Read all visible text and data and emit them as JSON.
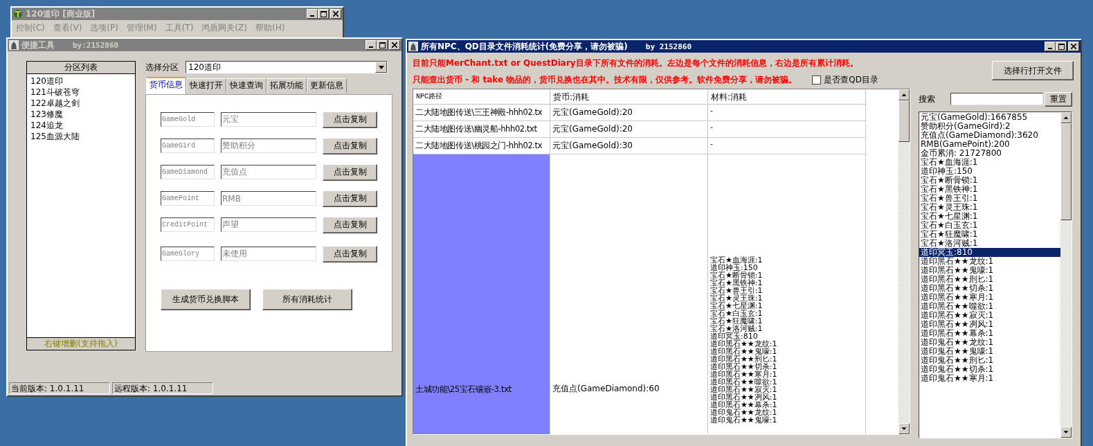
{
  "main_window": {
    "title": "120道印 [商业版]",
    "menu": [
      "控制(C)",
      "查看(V)",
      "选项(P)",
      "管理(M)",
      "工具(T)",
      "鸿盾网关(Z)",
      "帮助(H)"
    ]
  },
  "tool_window": {
    "title": "便捷工具",
    "author": "by:2152860",
    "partition_list": {
      "header": "分区列表",
      "items": [
        "120道印",
        "121斗破苍穹",
        "122卓越之剑",
        "123修魔",
        "124追龙",
        "125血源大陆"
      ],
      "footer": "右键增删(支持拖入)"
    },
    "partition_select": {
      "label": "选择分区",
      "value": "120道印"
    },
    "tabs": [
      {
        "label": "货币信息",
        "selected": true
      },
      {
        "label": "快速打开",
        "selected": false
      },
      {
        "label": "快速查询",
        "selected": false
      },
      {
        "label": "拓展功能",
        "selected": false
      },
      {
        "label": "更新信息",
        "selected": false
      }
    ],
    "currency_rows": [
      {
        "key": "GameGold",
        "name": "元宝",
        "button": "点击复制"
      },
      {
        "key": "GameGird",
        "name": "赞助积分",
        "button": "点击复制"
      },
      {
        "key": "GameDiamond",
        "name": "充值点",
        "button": "点击复制"
      },
      {
        "key": "GamePoint",
        "name": "RMB",
        "button": "点击复制"
      },
      {
        "key": "CreditPoint",
        "name": "声望",
        "button": "点击复制"
      },
      {
        "key": "GameGlory",
        "name": "未使用",
        "button": "点击复制"
      }
    ],
    "buttons": [
      "生成货币兑换脚本",
      "所有消耗统计"
    ],
    "status_bar": [
      "当前版本: 1.0.1.11",
      "远程版本: 1.0.1.11"
    ]
  },
  "stats_window": {
    "title": "所有NPC、QD目录文件消耗统计(免费分享，请勿被骗)",
    "author": "by 2152860",
    "notices": [
      "目前只能MerChant.txt or QuestDiary目录下所有文件的消耗。左边是每个文件的消耗信息，右边是所有累计消耗。",
      "只能查出货币 - 和 take 物品的，货币兑换也在其中。技术有限，仅供参考。软件免费分享，请勿被骗。"
    ],
    "qd_checkbox": {
      "label": "是否查QD目录",
      "checked": false
    },
    "open_button": "选择行打开文件",
    "table": {
      "columns": [
        "NPC路径",
        "货币:消耗",
        "材料:消耗"
      ],
      "rows": [
        {
          "path": "二大陆地图传送\\三王神殿-hhh02.tx",
          "currency": "元宝(GameGold):20",
          "materials": [
            "-"
          ],
          "selected": false
        },
        {
          "path": "二大陆地图传送\\幽灵船-hhh02.txt",
          "currency": "元宝(GameGold):20",
          "materials": [
            "-"
          ],
          "selected": false
        },
        {
          "path": "二大陆地图传送\\桃园之门-hhh02.tx",
          "currency": "元宝(GameGold):30",
          "materials": [
            "-"
          ],
          "selected": false
        },
        {
          "path": "土城功能\\25宝石镶嵌-3.txt",
          "currency": "充值点(GameDiamond):60",
          "selected": true,
          "materials": [
            "宝石★血海涯:1",
            "道印神玉:150",
            "宝石★断骨锁:1",
            "宝石★黑铁神:1",
            "宝石★兽王引:1",
            "宝石★灵王珠:1",
            "宝石★七星渊:1",
            "宝石★白玉玄:1",
            "宝石★狂魔啸:1",
            "宝石★洛河贼:1",
            "道印冥玉:810",
            "道印黑石★★龙纹:1",
            "道印黑石★★鬼嚎:1",
            "道印黑石★★刑匕:1",
            "道印黑石★★切杀:1",
            "道印黑石★★寒月:1",
            "道印黑石★★噬欲:1",
            "道印黑石★★寂灭:1",
            "道印黑石★★冽风:1",
            "道印黑石★★幕杀:1",
            "道印鬼石★★龙纹:1",
            "道印鬼石★★鬼嚎:1"
          ]
        }
      ]
    },
    "search": {
      "label": "搜索",
      "button": "重置"
    },
    "totals": [
      {
        "text": "元宝(GameGold):1667855",
        "selected": false
      },
      {
        "text": "赞助积分(GameGird):2",
        "selected": false
      },
      {
        "text": "充值点(GameDiamond):3620",
        "selected": false
      },
      {
        "text": "RMB(GamePoint):200",
        "selected": false
      },
      {
        "text": "金币累消: 21727800",
        "selected": false
      },
      {
        "text": "宝石★血海涯:1",
        "selected": false
      },
      {
        "text": "道印神玉:150",
        "selected": false
      },
      {
        "text": "宝石★断骨锁:1",
        "selected": false
      },
      {
        "text": "宝石★黑铁神:1",
        "selected": false
      },
      {
        "text": "宝石★兽王引:1",
        "selected": false
      },
      {
        "text": "宝石★灵王珠:1",
        "selected": false
      },
      {
        "text": "宝石★七星渊:1",
        "selected": false
      },
      {
        "text": "宝石★白玉玄:1",
        "selected": false
      },
      {
        "text": "宝石★狂魔啸:1",
        "selected": false
      },
      {
        "text": "宝石★洛河贼:1",
        "selected": false
      },
      {
        "text": "道印冥玉:810",
        "selected": true
      },
      {
        "text": "道印黑石★★龙纹:1",
        "selected": false
      },
      {
        "text": "道印黑石★★鬼嚎:1",
        "selected": false
      },
      {
        "text": "道印黑石★★刑匕:1",
        "selected": false
      },
      {
        "text": "道印黑石★★切杀:1",
        "selected": false
      },
      {
        "text": "道印黑石★★寒月:1",
        "selected": false
      },
      {
        "text": "道印黑石★★噬欲:1",
        "selected": false
      },
      {
        "text": "道印黑石★★寂灭:1",
        "selected": false
      },
      {
        "text": "道印黑石★★冽风:1",
        "selected": false
      },
      {
        "text": "道印黑石★★幕杀:1",
        "selected": false
      },
      {
        "text": "道印鬼石★★龙纹:1",
        "selected": false
      },
      {
        "text": "道印鬼石★★鬼嚎:1",
        "selected": false
      },
      {
        "text": "道印鬼石★★刑匕:1",
        "selected": false
      },
      {
        "text": "道印鬼石★★切杀:1",
        "selected": false
      },
      {
        "text": "道印鬼石★★寒月:1",
        "selected": false
      }
    ]
  }
}
